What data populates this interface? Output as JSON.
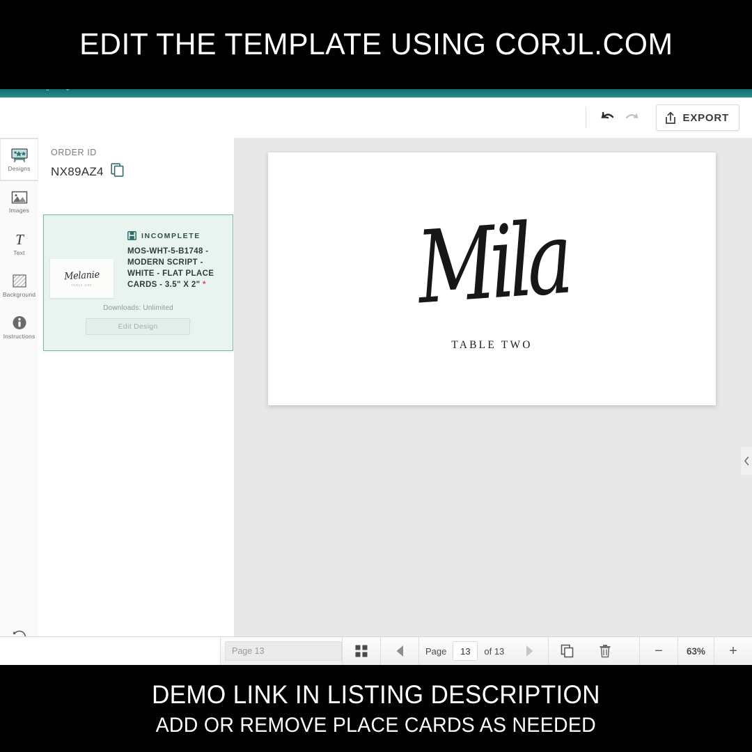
{
  "overlay": {
    "top_text": "EDIT THE TEMPLATE USING CORJL.COM",
    "bottom_line1": "DEMO LINK IN LISTING DESCRIPTION",
    "bottom_line2": "ADD OR REMOVE PLACE CARDS AS NEEDED"
  },
  "header": {
    "teal_glyphs": "⇧ ⌄  ⌃",
    "accent_color": "#17787a"
  },
  "toolbar": {
    "undo_icon": "undo-arrow-icon",
    "redo_icon": "redo-arrow-icon",
    "export_icon": "upload-share-icon",
    "export_label": "EXPORT"
  },
  "rail": {
    "items": [
      {
        "label": "Designs",
        "icon": "designs-grid-icon",
        "active": true
      },
      {
        "label": "Images",
        "icon": "picture-mountain-icon",
        "active": false
      },
      {
        "label": "Text",
        "icon": "text-t-icon",
        "active": false
      },
      {
        "label": "Background",
        "icon": "hatched-square-icon",
        "active": false
      },
      {
        "label": "Instructions",
        "icon": "info-circle-icon",
        "active": false
      }
    ],
    "revert": {
      "label": "Revert",
      "icon": "revert-circular-arrow-icon"
    }
  },
  "order": {
    "order_id_label": "ORDER ID",
    "order_id_value": "NX89AZ4",
    "copy_icon": "copy-duplicate-icon",
    "design": {
      "status_icon": "save-disk-icon",
      "status_label": "INCOMPLETE",
      "title": "MOS-WHT-5-B1748 - MODERN SCRIPT - WHITE - FLAT PLACE CARDS - 3.5\" X 2\"",
      "required_marker": "*",
      "thumbnail_name": "Melanie",
      "thumbnail_sub": "TABLE ONE",
      "downloads": "Downloads: Unlimited",
      "edit_label": "Edit Design",
      "card_bg": "#e9f4f1",
      "card_border": "#7fb3ab"
    }
  },
  "canvas": {
    "card_name": "Mila",
    "card_table": "TABLE TWO",
    "background": "#e8e8e8",
    "collapse_icon": "chevron-left-icon",
    "cursor_icon": "mouse-pointer-icon"
  },
  "bottombar": {
    "page_search_placeholder": "Page 13",
    "grid_view_icon": "grid-thumbnails-icon",
    "prev_icon": "previous-triangle-icon",
    "next_icon": "next-triangle-icon",
    "page_word": "Page",
    "page_current": "13",
    "page_of": "of 13",
    "duplicate_icon": "duplicate-page-icon",
    "delete_icon": "trash-delete-icon",
    "zoom_out_icon": "minus-icon",
    "zoom_level": "63%",
    "zoom_in_icon": "plus-icon"
  }
}
